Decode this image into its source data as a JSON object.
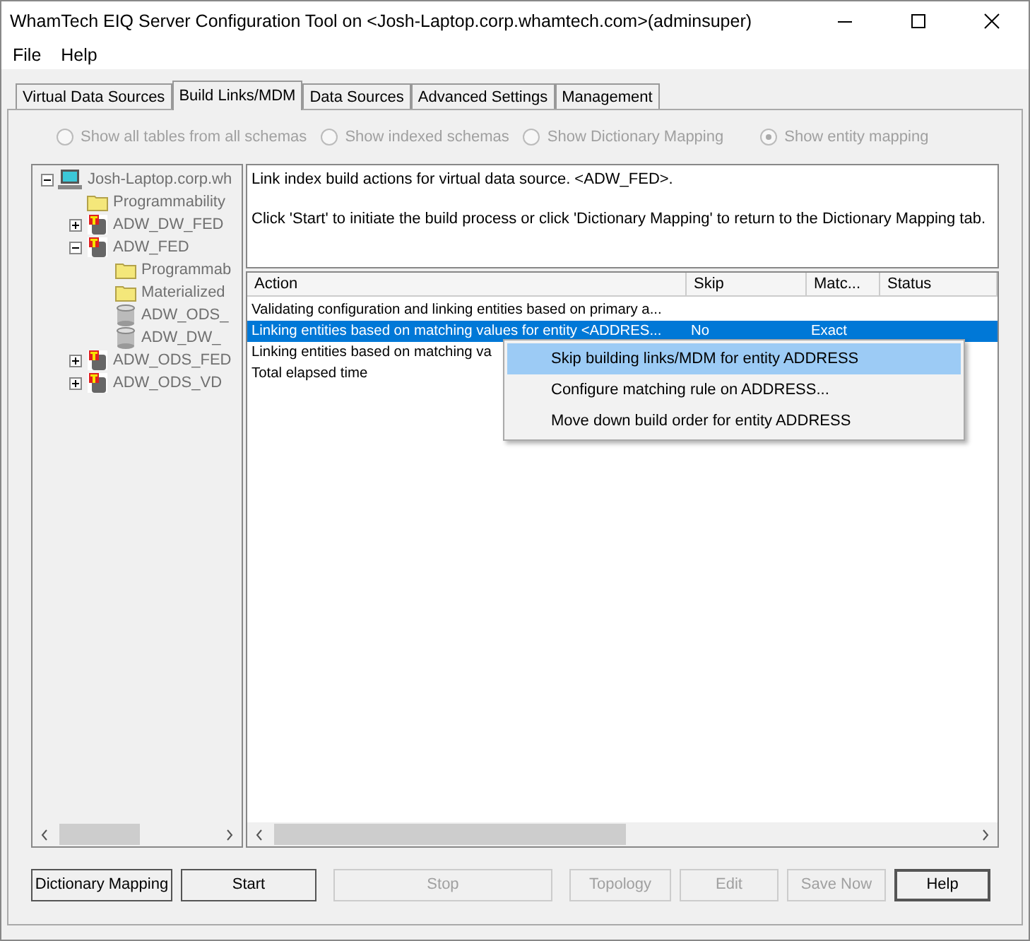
{
  "window": {
    "title": "WhamTech EIQ Server Configuration Tool on <Josh-Laptop.corp.whamtech.com>(adminsuper)"
  },
  "menu": [
    "File",
    "Help"
  ],
  "tabs": [
    {
      "label": "Virtual Data Sources",
      "selected": false
    },
    {
      "label": "Build Links/MDM",
      "selected": true
    },
    {
      "label": "Data Sources",
      "selected": false
    },
    {
      "label": "Advanced Settings",
      "selected": false
    },
    {
      "label": "Management",
      "selected": false
    }
  ],
  "view_options": [
    {
      "label": "Show all tables from all schemas",
      "selected": false
    },
    {
      "label": "Show indexed schemas",
      "selected": false
    },
    {
      "label": "Show Dictionary Mapping",
      "selected": false
    },
    {
      "label": "Show entity mapping",
      "selected": true
    }
  ],
  "tree": [
    {
      "label": "Josh-Laptop.corp.wh",
      "kind": "computer",
      "expanded": true,
      "children": [
        {
          "label": "Programmability",
          "kind": "folder"
        },
        {
          "label": "ADW_DW_FED",
          "kind": "source",
          "expanded": false
        },
        {
          "label": "ADW_FED",
          "kind": "source",
          "expanded": true,
          "children": [
            {
              "label": "Programmab",
              "kind": "folder"
            },
            {
              "label": "Materialized",
              "kind": "folder"
            },
            {
              "label": "ADW_ODS_",
              "kind": "database"
            },
            {
              "label": "ADW_DW_",
              "kind": "database"
            }
          ]
        },
        {
          "label": "ADW_ODS_FED",
          "kind": "source",
          "expanded": false
        },
        {
          "label": "ADW_ODS_VD",
          "kind": "source",
          "expanded": false
        }
      ]
    }
  ],
  "info": [
    "Link index build actions for virtual data source. <ADW_FED>.",
    "Click 'Start' to initiate the build process or click 'Dictionary Mapping' to return to the Dictionary Mapping tab."
  ],
  "table": {
    "columns": [
      "Action",
      "Skip",
      "Matc...",
      "Status"
    ],
    "rows": [
      {
        "cells": [
          "Validating configuration and linking entities based on primary a...",
          "",
          "",
          ""
        ],
        "selected": false
      },
      {
        "cells": [
          "Linking entities based on matching values for entity <ADDRES...",
          "No",
          "Exact",
          ""
        ],
        "selected": true
      },
      {
        "cells": [
          "Linking entities based on matching va",
          "",
          "",
          ""
        ],
        "selected": false
      },
      {
        "cells": [
          "Total elapsed time",
          "",
          "",
          ""
        ],
        "selected": false
      }
    ]
  },
  "context_menu": [
    {
      "label": "Skip building links/MDM  for entity ADDRESS",
      "selected": true
    },
    {
      "label": "Configure matching rule on ADDRESS...",
      "selected": false
    },
    {
      "label": "Move down build order for entity ADDRESS",
      "selected": false
    }
  ],
  "buttons": [
    {
      "label": "Dictionary Mapping",
      "disabled": false
    },
    {
      "label": "Start",
      "disabled": false
    },
    {
      "label": "Stop",
      "disabled": true
    },
    {
      "label": "Topology",
      "disabled": true
    },
    {
      "label": "Edit",
      "disabled": true
    },
    {
      "label": "Save Now",
      "disabled": true
    },
    {
      "label": "Help",
      "disabled": false
    }
  ]
}
